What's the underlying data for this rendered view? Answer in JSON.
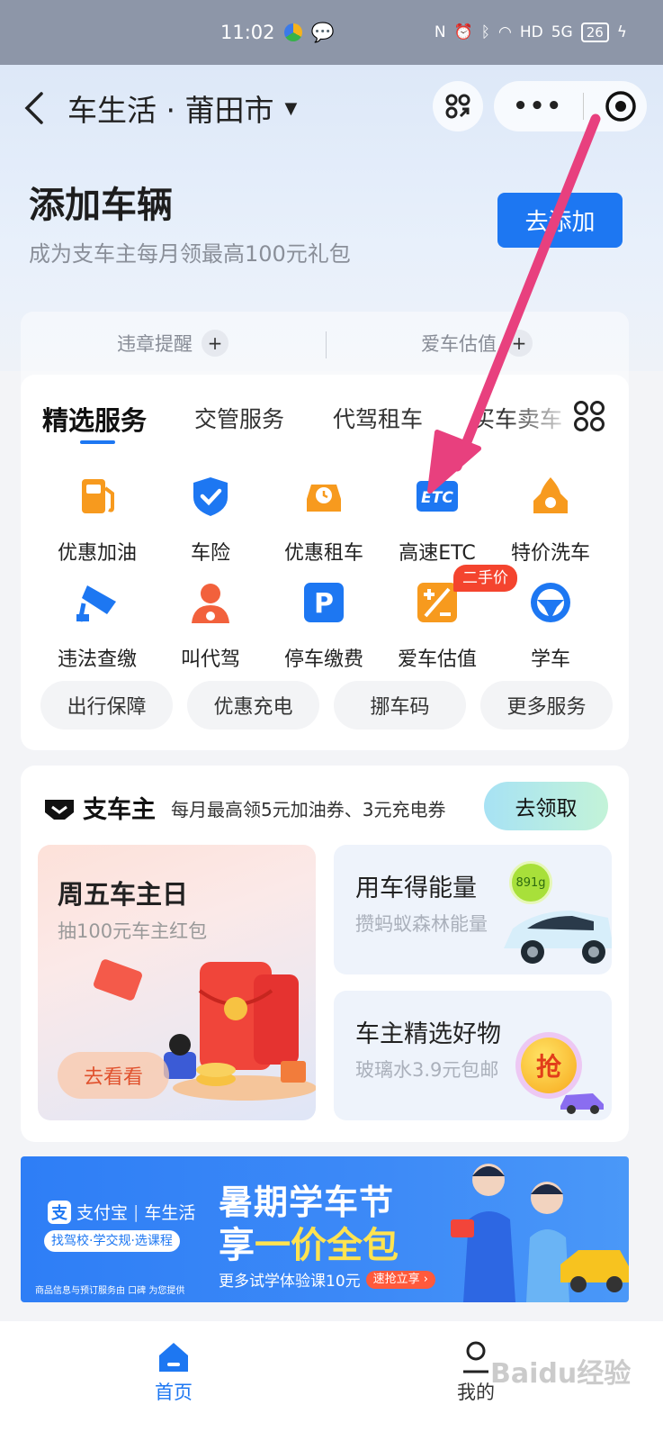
{
  "status_bar": {
    "time": "11:02",
    "network": "5G",
    "hd": "HD",
    "battery": "26"
  },
  "nav": {
    "city_title": "车生活 · 莆田市",
    "more": "•••"
  },
  "add_vehicle": {
    "title": "添加车辆",
    "subtitle": "成为支车主每月领最高100元礼包",
    "button": "去添加"
  },
  "quick_actions": [
    {
      "label": "违章提醒"
    },
    {
      "label": "爱车估值"
    }
  ],
  "service_tabs": [
    {
      "label": "精选服务"
    },
    {
      "label": "交管服务"
    },
    {
      "label": "代驾租车"
    },
    {
      "label": "买车卖车"
    }
  ],
  "services": [
    {
      "label": "优惠加油",
      "icon": "fuel-pump-icon"
    },
    {
      "label": "车险",
      "icon": "shield-check-icon"
    },
    {
      "label": "优惠租车",
      "icon": "car-clock-icon"
    },
    {
      "label": "高速ETC",
      "icon": "etc-icon"
    },
    {
      "label": "特价洗车",
      "icon": "car-wash-icon"
    },
    {
      "label": "违法查缴",
      "icon": "camera-icon"
    },
    {
      "label": "叫代驾",
      "icon": "driver-icon"
    },
    {
      "label": "停车缴费",
      "icon": "parking-icon"
    },
    {
      "label": "爱车估值",
      "icon": "valuation-icon"
    },
    {
      "label": "学车",
      "icon": "steering-wheel-icon"
    }
  ],
  "valuation_badge": "二手价",
  "service_pills": [
    {
      "label": "出行保障"
    },
    {
      "label": "优惠充电"
    },
    {
      "label": "挪车码"
    },
    {
      "label": "更多服务"
    }
  ],
  "owner": {
    "brand": "支车主",
    "desc": "每月最高领5元加油券、3元充电券",
    "button": "去领取",
    "friday": {
      "title": "周五车主日",
      "subtitle": "抽100元车主红包",
      "button": "去看看"
    },
    "energy": {
      "title": "用车得能量",
      "subtitle": "攒蚂蚁森林能量",
      "badge": "891g"
    },
    "goods": {
      "title": "车主精选好物",
      "subtitle": "玻璃水3.9元包邮",
      "badge": "抢"
    }
  },
  "banner": {
    "logo": "支付宝",
    "logo_app": "车生活",
    "tag": "找驾校·学交规·选课程",
    "title1": "暑期学车节",
    "title2_pre": "享",
    "title2_highlight": "一价全包",
    "cta_text": "更多试学体验课10元",
    "cta_button": "速抢立享 ›",
    "footer": "商品信息与预订服务由 口碑 为您提供"
  },
  "tabbar": {
    "home": "首页",
    "mine": "我的"
  },
  "watermark": "Baidu经验",
  "colors": {
    "accent": "#1d77f2",
    "icon_orange": "#f79a1e",
    "arrow": "#e8407e",
    "badge_red": "#f4442e"
  }
}
